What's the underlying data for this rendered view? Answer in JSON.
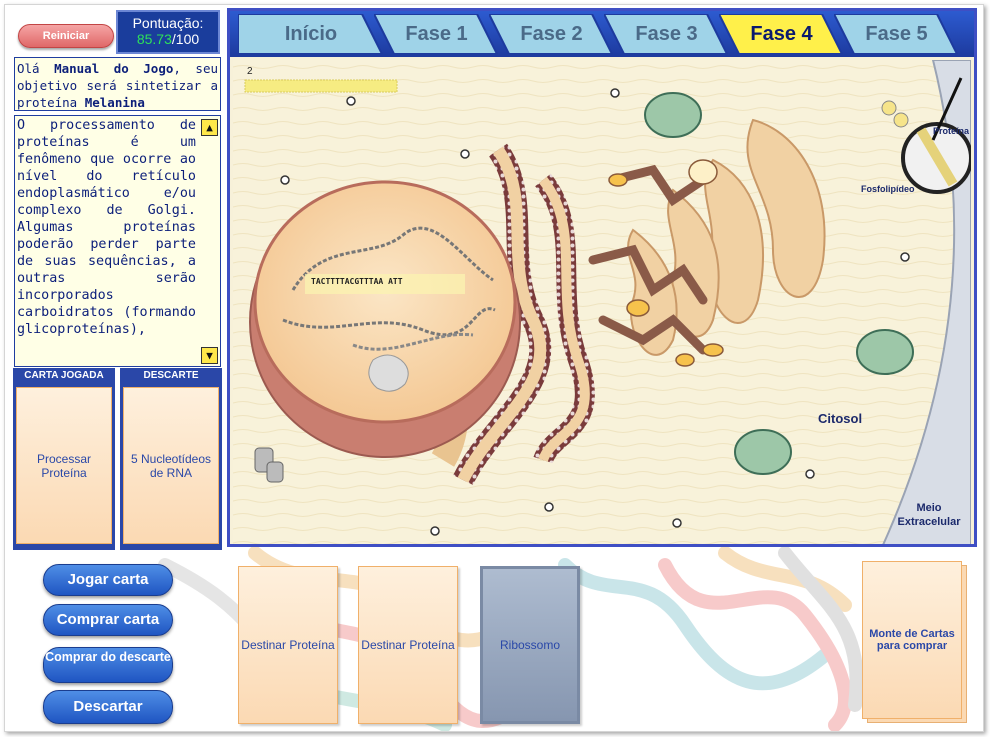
{
  "controls": {
    "restart_label": "Reiniciar",
    "score_label": "Pontuação:",
    "score_value": "85.73",
    "score_max": "/100"
  },
  "intro": {
    "part1": "Olá ",
    "player": "Manual do Jogo",
    "part2": ", seu objetivo será sintetizar a proteína ",
    "protein": "Melanina"
  },
  "info": {
    "text": "O processamento de proteínas é um fenômeno que ocorre ao nível do retículo endoplasmático e/ou complexo de Golgi. Algumas proteínas poderão perder parte de suas sequências, a outras serão incorporados carboidratos (formando glicoproteínas),",
    "scroll_up": "▲",
    "scroll_down": "▼"
  },
  "slots": {
    "played_title": "CARTA JOGADA",
    "played_card": "Processar Proteína",
    "discard_title": "DESCARTE",
    "discard_card": "5 Nucleotídeos de RNA"
  },
  "actions": {
    "play": "Jogar carta",
    "buy": "Comprar carta",
    "buy_discard": "Comprar do descarte",
    "discard": "Descartar"
  },
  "hand": [
    "Destinar Proteína",
    "Destinar Proteína",
    "Ribossomo"
  ],
  "deck_label": "Monte de Cartas para comprar",
  "tabs": [
    {
      "label": "Início",
      "active": false
    },
    {
      "label": "Fase 1",
      "active": false
    },
    {
      "label": "Fase 2",
      "active": false
    },
    {
      "label": "Fase 3",
      "active": false
    },
    {
      "label": "Fase 4",
      "active": true
    },
    {
      "label": "Fase 5",
      "active": false
    }
  ],
  "scene": {
    "strand_number": "2",
    "dna_sequence": "TACTTTTACGTTTAA ATT",
    "label_protein": "Proteína",
    "label_phospholipid": "Fosfolipídeo",
    "label_cytosol": "Citosol",
    "label_extracellular": "Meio Extracelular"
  },
  "colors": {
    "board_border": "#3f4fc4",
    "tab_bar": "#1d3a9e",
    "tab_inactive": "#9fd3e8",
    "tab_active": "#fff04a",
    "card": "#fbd9b3",
    "score_green": "#2ee05a"
  }
}
